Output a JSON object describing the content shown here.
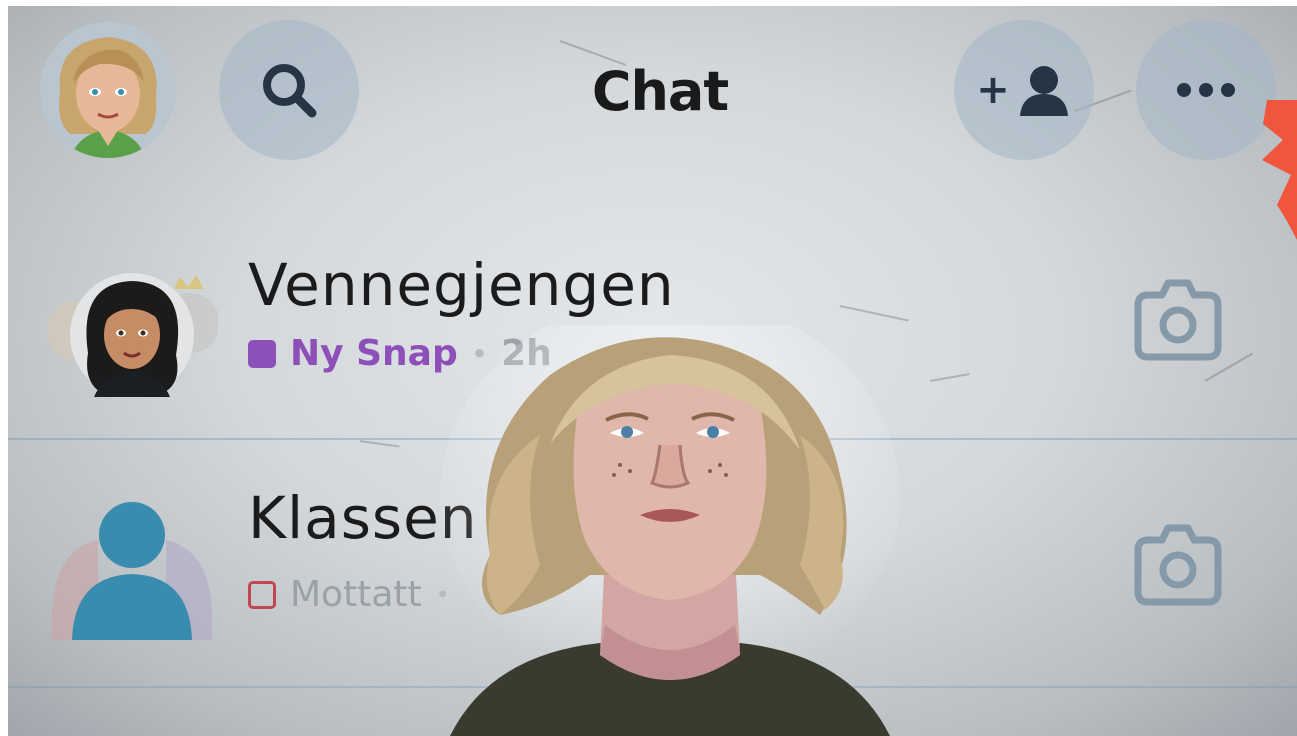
{
  "header": {
    "title": "Chat",
    "profile_icon": "bitmoji-avatar-icon",
    "search_icon": "search-icon",
    "add_friend_label": "+",
    "add_friend_icon": "add-friend-icon",
    "more_icon": "more-icon"
  },
  "chats": [
    {
      "name": "Vennegjengen",
      "status": "Ny Snap",
      "status_color": "#8d4fb8",
      "separator": "•",
      "time": "2h",
      "camera_icon": "camera-icon"
    },
    {
      "name": "Klassen",
      "status": "Mottatt",
      "status_color": "#c2464e",
      "separator": "•",
      "time": "",
      "camera_icon": "camera-icon"
    }
  ],
  "colors": {
    "accent_red": "#f0553d",
    "button_bg": "#a3b7c6",
    "snap_purple": "#8d4fb8",
    "received_red": "#c2464e"
  }
}
